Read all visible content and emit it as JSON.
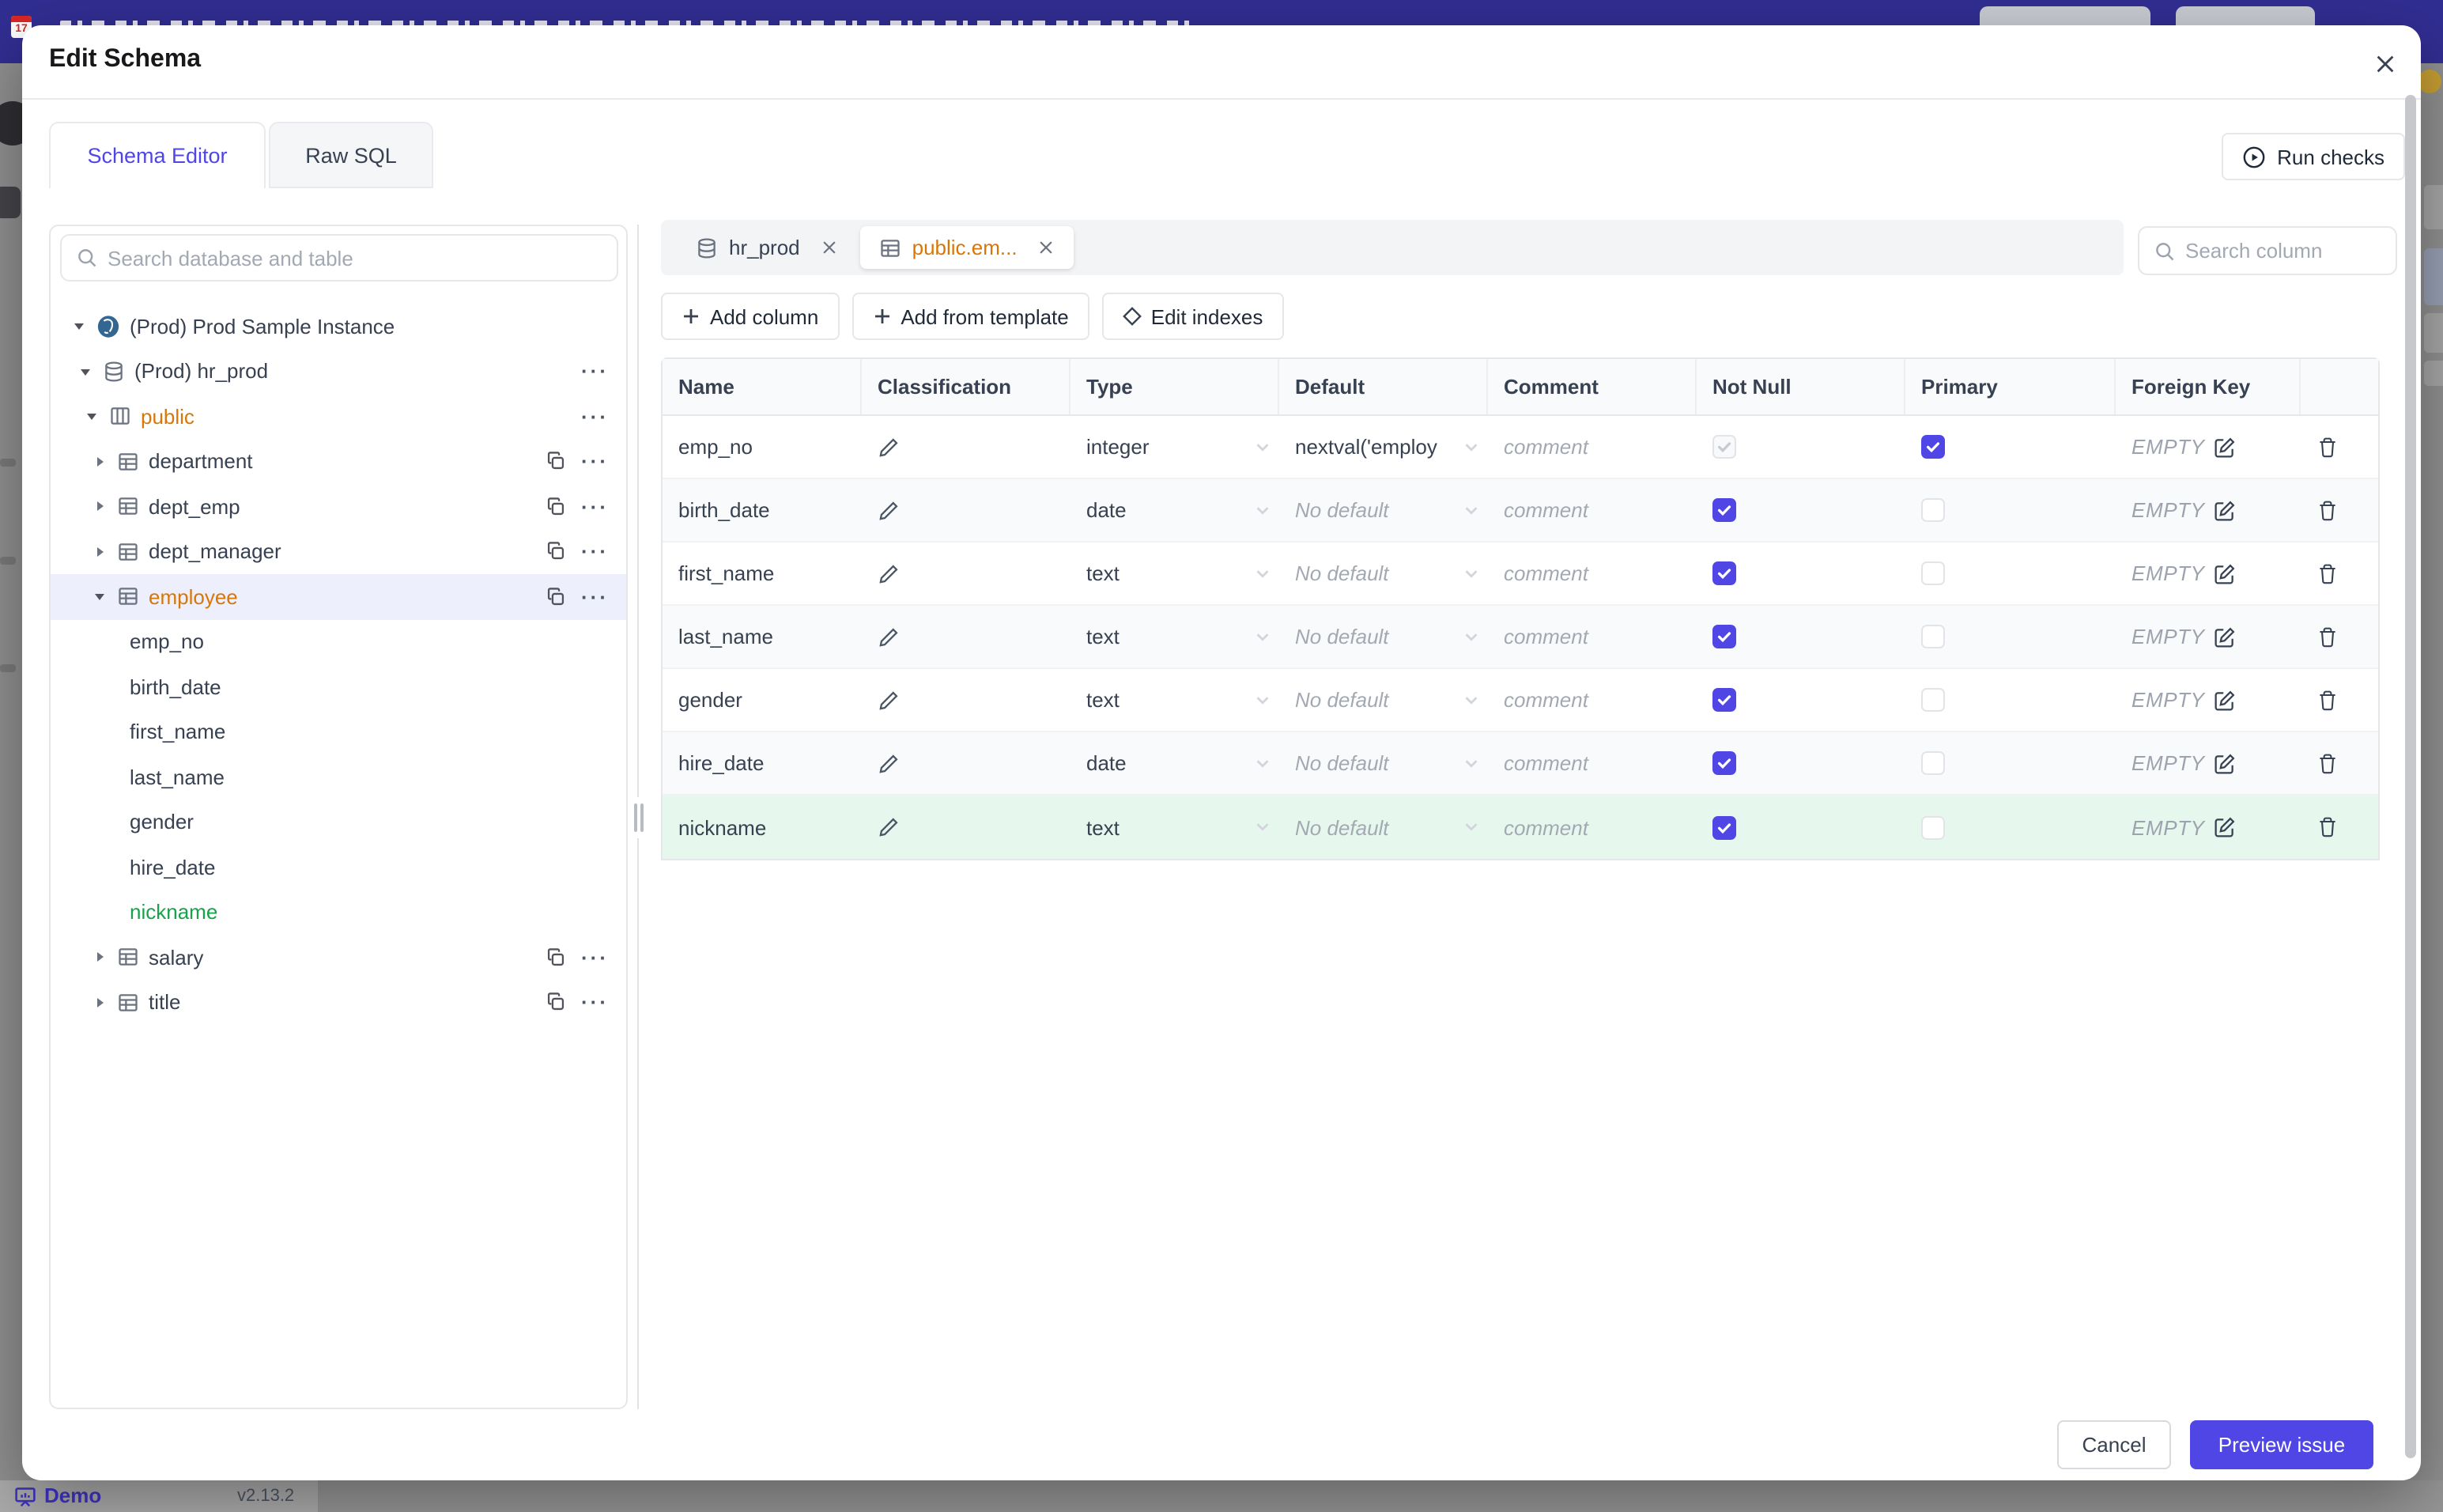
{
  "colors": {
    "accent": "#4f46e5",
    "header_bg": "#312e93",
    "orange": "#d97706",
    "green": "#16a34a",
    "green_row_bg": "#e6f7ed",
    "selected_row_bg": "#edeffd"
  },
  "page": {
    "demo_label": "Demo",
    "version": "v2.13.2"
  },
  "modal": {
    "title": "Edit Schema"
  },
  "tabs": {
    "schema_editor": "Schema Editor",
    "raw_sql": "Raw SQL"
  },
  "toolbar": {
    "run_checks": "Run checks"
  },
  "sidebar": {
    "search_placeholder": "Search database and table",
    "tree": {
      "items": [
        {
          "label": "(Prod) Prod Sample Instance"
        },
        {
          "label": "(Prod) hr_prod"
        },
        {
          "label": "public"
        },
        {
          "label": "department"
        },
        {
          "label": "dept_emp"
        },
        {
          "label": "dept_manager"
        },
        {
          "label": "employee"
        },
        {
          "label": "emp_no"
        },
        {
          "label": "birth_date"
        },
        {
          "label": "first_name"
        },
        {
          "label": "last_name"
        },
        {
          "label": "gender"
        },
        {
          "label": "hire_date"
        },
        {
          "label": "nickname"
        },
        {
          "label": "salary"
        },
        {
          "label": "title"
        }
      ]
    }
  },
  "editor": {
    "chips": [
      {
        "label": "hr_prod"
      },
      {
        "label": "public.em..."
      }
    ],
    "search_placeholder": "Search column",
    "actions": {
      "add_column": "Add column",
      "add_from_template": "Add from template",
      "edit_indexes": "Edit indexes"
    },
    "headers": [
      "Name",
      "Classification",
      "Type",
      "Default",
      "Comment",
      "Not Null",
      "Primary",
      "Foreign Key"
    ],
    "comment_placeholder": "comment",
    "rows": [
      {
        "name": "emp_no",
        "type": "integer",
        "default": "nextval('employ",
        "foreign_key": "EMPTY",
        "not_null": true,
        "not_null_disabled": true,
        "primary": true
      },
      {
        "name": "birth_date",
        "type": "date",
        "default": "No default",
        "foreign_key": "EMPTY",
        "not_null": true,
        "primary": false
      },
      {
        "name": "first_name",
        "type": "text",
        "default": "No default",
        "foreign_key": "EMPTY",
        "not_null": true,
        "primary": false
      },
      {
        "name": "last_name",
        "type": "text",
        "default": "No default",
        "foreign_key": "EMPTY",
        "not_null": true,
        "primary": false
      },
      {
        "name": "gender",
        "type": "text",
        "default": "No default",
        "foreign_key": "EMPTY",
        "not_null": true,
        "primary": false
      },
      {
        "name": "hire_date",
        "type": "date",
        "default": "No default",
        "foreign_key": "EMPTY",
        "not_null": true,
        "primary": false
      },
      {
        "name": "nickname",
        "type": "text",
        "default": "No default",
        "foreign_key": "EMPTY",
        "not_null": true,
        "primary": false,
        "status": "new"
      }
    ]
  },
  "footer": {
    "cancel": "Cancel",
    "preview_issue": "Preview issue"
  }
}
